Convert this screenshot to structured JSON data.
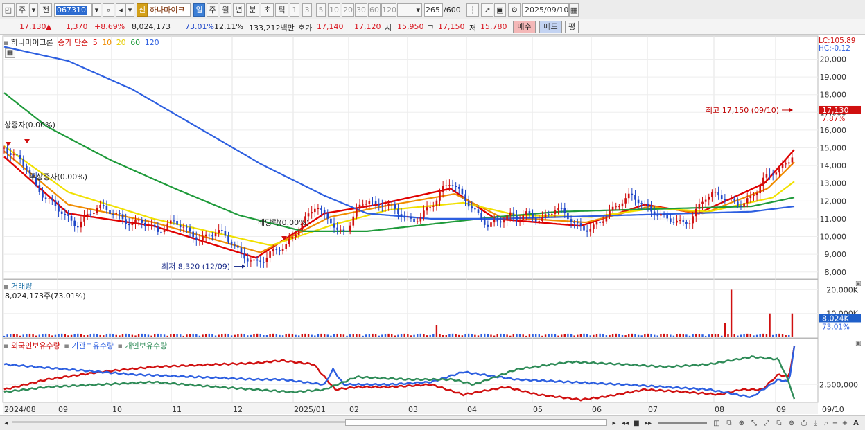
{
  "toolbar": {
    "period_type": "주",
    "prev_label": "전",
    "stock_code": "067310",
    "shin_label": "신",
    "stock_name": "하나마이크",
    "periods": [
      "일",
      "주",
      "월",
      "년",
      "분",
      "초",
      "틱"
    ],
    "active_period": "일",
    "intervals": [
      "1",
      "3",
      "5",
      "10",
      "20",
      "30",
      "60",
      "120"
    ],
    "bar_count": "265",
    "bar_total": "/600",
    "date": "2025/09/10"
  },
  "quote": {
    "price": "17,130",
    "change": "1,370",
    "change_pct": "+8.69%",
    "volume": "8,024,173",
    "volume_ratio": "73.01%",
    "turnover": "12.11%",
    "amount": "133,212백만",
    "bid_ask_label": "호가",
    "ask": "17,140",
    "bid": "17,120",
    "open_label": "시",
    "open": "15,950",
    "high_label": "고",
    "high": "17,150",
    "low_label": "저",
    "low": "15,780",
    "buy_label": "매수",
    "sell_label": "매도",
    "eval_label": "평"
  },
  "price_panel": {
    "legend": {
      "name": "하나마이크론",
      "type": "종가 단순",
      "mas": [
        {
          "label": "5",
          "color": "#e00000"
        },
        {
          "label": "10",
          "color": "#f08c00"
        },
        {
          "label": "20",
          "color": "#f0e000"
        },
        {
          "label": "60",
          "color": "#1e9a3a"
        },
        {
          "label": "120",
          "color": "#2d5fe0"
        }
      ]
    },
    "lc_label": "LC:105.89",
    "hc_label": "HC:-0.12",
    "y_ticks": [
      "20,000",
      "19,000",
      "18,000",
      "17,000",
      "16,000",
      "15,000",
      "14,000",
      "13,000",
      "12,000",
      "11,000",
      "10,000",
      "9,000",
      "8,000"
    ],
    "current_price": "17,130",
    "current_pct": "7.87%",
    "annotations": {
      "high": "최고 17,150 (09/10)",
      "low": "최저 8,320 (12/09)",
      "event1": "상증자(0.00%)",
      "event2": "무상증자(0.00%)",
      "event3": "배당락(0.00%)"
    }
  },
  "volume_panel": {
    "title": "거래량",
    "value": "8,024,173주(73.01%)",
    "y_ticks": [
      "20,000K",
      "10,000K"
    ],
    "current": "8,024K",
    "current_pct": "73.01%"
  },
  "holdings_panel": {
    "legend": [
      {
        "label": "외국인보유수량",
        "color": "#d01010"
      },
      {
        "label": "기관보유수량",
        "color": "#2d5fe0"
      },
      {
        "label": "개인보유수량",
        "color": "#2e8b57"
      }
    ],
    "y_ticks": [
      "2,500,000"
    ]
  },
  "x_axis": {
    "labels": [
      "2024/08",
      "09",
      "10",
      "11",
      "12",
      "2025/01",
      "02",
      "03",
      "04",
      "05",
      "06",
      "07",
      "08",
      "09"
    ],
    "last_date": "09/10"
  },
  "chart_data": {
    "type": "candlestick",
    "title": "하나마이크론",
    "ylim": [
      7600,
      20800
    ],
    "price_path": [
      [
        0,
        15000
      ],
      [
        8,
        14600
      ],
      [
        15,
        14300
      ],
      [
        22,
        13800
      ],
      [
        30,
        12800
      ],
      [
        38,
        12200
      ],
      [
        45,
        11900
      ],
      [
        52,
        11500
      ],
      [
        60,
        11000
      ],
      [
        68,
        10600
      ],
      [
        75,
        11000
      ],
      [
        80,
        11300
      ],
      [
        88,
        11700
      ],
      [
        96,
        11500
      ],
      [
        104,
        11300
      ],
      [
        112,
        10900
      ],
      [
        120,
        10700
      ],
      [
        128,
        10900
      ],
      [
        136,
        10600
      ],
      [
        144,
        10300
      ],
      [
        152,
        10600
      ],
      [
        160,
        10900
      ],
      [
        168,
        10500
      ],
      [
        176,
        10100
      ],
      [
        184,
        9800
      ],
      [
        192,
        10100
      ],
      [
        200,
        10300
      ],
      [
        208,
        10000
      ],
      [
        215,
        9500
      ],
      [
        222,
        9000
      ],
      [
        229,
        8700
      ],
      [
        236,
        8500
      ],
      [
        243,
        8700
      ],
      [
        250,
        9100
      ],
      [
        257,
        9300
      ],
      [
        264,
        9500
      ],
      [
        271,
        10000
      ],
      [
        278,
        10700
      ],
      [
        285,
        11200
      ],
      [
        292,
        11800
      ],
      [
        299,
        11200
      ],
      [
        306,
        10900
      ],
      [
        313,
        10200
      ],
      [
        320,
        10300
      ],
      [
        327,
        11100
      ],
      [
        334,
        11800
      ],
      [
        341,
        12100
      ],
      [
        348,
        11700
      ],
      [
        355,
        11900
      ],
      [
        362,
        11700
      ],
      [
        369,
        11400
      ],
      [
        376,
        11000
      ],
      [
        383,
        10900
      ],
      [
        390,
        11100
      ],
      [
        397,
        11600
      ],
      [
        404,
        12000
      ],
      [
        411,
        12700
      ],
      [
        418,
        13100
      ],
      [
        425,
        12600
      ],
      [
        432,
        12100
      ],
      [
        439,
        11500
      ],
      [
        446,
        11100
      ],
      [
        453,
        10600
      ],
      [
        460,
        10800
      ],
      [
        467,
        11000
      ],
      [
        474,
        11200
      ],
      [
        481,
        11000
      ],
      [
        488,
        11300
      ],
      [
        495,
        11100
      ],
      [
        502,
        10900
      ],
      [
        509,
        11200
      ],
      [
        516,
        11600
      ],
      [
        523,
        11400
      ],
      [
        530,
        11000
      ],
      [
        537,
        10600
      ],
      [
        544,
        10400
      ],
      [
        551,
        10500
      ],
      [
        558,
        10800
      ],
      [
        565,
        11300
      ],
      [
        572,
        11600
      ],
      [
        579,
        12000
      ],
      [
        586,
        12300
      ],
      [
        593,
        12100
      ],
      [
        600,
        11700
      ],
      [
        607,
        11400
      ],
      [
        614,
        11200
      ],
      [
        621,
        11000
      ],
      [
        628,
        10900
      ],
      [
        635,
        10700
      ],
      [
        642,
        10900
      ],
      [
        649,
        11500
      ],
      [
        656,
        12200
      ],
      [
        663,
        12400
      ],
      [
        670,
        12300
      ],
      [
        677,
        12100
      ],
      [
        684,
        11900
      ],
      [
        691,
        11800
      ],
      [
        698,
        12100
      ],
      [
        705,
        12600
      ],
      [
        712,
        13300
      ],
      [
        719,
        13600
      ],
      [
        726,
        13800
      ],
      [
        733,
        14100
      ],
      [
        738,
        14600
      ],
      [
        740,
        17130
      ]
    ],
    "ma_lines": [
      {
        "name": "5",
        "color": "#e00000",
        "values": [
          [
            0,
            14500
          ],
          [
            60,
            11300
          ],
          [
            140,
            10600
          ],
          [
            236,
            8800
          ],
          [
            300,
            11300
          ],
          [
            350,
            11800
          ],
          [
            418,
            12700
          ],
          [
            460,
            11000
          ],
          [
            540,
            10600
          ],
          [
            600,
            11800
          ],
          [
            650,
            11300
          ],
          [
            712,
            13000
          ],
          [
            740,
            14900
          ]
        ]
      },
      {
        "name": "10",
        "color": "#f08c00",
        "values": [
          [
            0,
            14800
          ],
          [
            60,
            11800
          ],
          [
            140,
            10800
          ],
          [
            240,
            9100
          ],
          [
            305,
            11100
          ],
          [
            355,
            11700
          ],
          [
            422,
            12400
          ],
          [
            465,
            11100
          ],
          [
            545,
            10800
          ],
          [
            605,
            11700
          ],
          [
            655,
            11300
          ],
          [
            715,
            12700
          ],
          [
            740,
            14200
          ]
        ]
      },
      {
        "name": "20",
        "color": "#f0e000",
        "values": [
          [
            0,
            15100
          ],
          [
            60,
            12500
          ],
          [
            140,
            11000
          ],
          [
            250,
            9500
          ],
          [
            310,
            10700
          ],
          [
            360,
            11500
          ],
          [
            430,
            11900
          ],
          [
            480,
            11200
          ],
          [
            550,
            11100
          ],
          [
            610,
            11600
          ],
          [
            660,
            11400
          ],
          [
            720,
            12200
          ],
          [
            740,
            13100
          ]
        ]
      },
      {
        "name": "60",
        "color": "#1e9a3a",
        "values": [
          [
            0,
            18100
          ],
          [
            40,
            16200
          ],
          [
            100,
            14300
          ],
          [
            160,
            12700
          ],
          [
            220,
            11200
          ],
          [
            280,
            10300
          ],
          [
            340,
            10300
          ],
          [
            400,
            10700
          ],
          [
            460,
            11100
          ],
          [
            520,
            11400
          ],
          [
            580,
            11500
          ],
          [
            640,
            11600
          ],
          [
            700,
            11700
          ],
          [
            740,
            12200
          ]
        ]
      },
      {
        "name": "120",
        "color": "#2d5fe0",
        "values": [
          [
            0,
            20700
          ],
          [
            60,
            19900
          ],
          [
            120,
            18300
          ],
          [
            180,
            16200
          ],
          [
            240,
            14100
          ],
          [
            300,
            12300
          ],
          [
            340,
            11300
          ],
          [
            400,
            11000
          ],
          [
            460,
            11000
          ],
          [
            520,
            11100
          ],
          [
            580,
            11200
          ],
          [
            640,
            11300
          ],
          [
            700,
            11400
          ],
          [
            740,
            11700
          ]
        ]
      }
    ],
    "volume_peaks": [
      {
        "x": 404,
        "value": 5000,
        "color": "#d01010"
      },
      {
        "x": 680,
        "value": 20000,
        "color": "#d01010"
      },
      {
        "x": 676,
        "value": 6000,
        "color": "#d01010"
      },
      {
        "x": 716,
        "value": 10000,
        "color": "#d01010"
      },
      {
        "x": 738,
        "value": 10000,
        "color": "#d01010"
      },
      {
        "x": 740,
        "value": 8024,
        "color": "#d01010"
      }
    ],
    "holdings": [
      {
        "name": "외국인보유수량",
        "color": "#d01010",
        "values": [
          [
            0,
            2300
          ],
          [
            40,
            2700
          ],
          [
            90,
            3000
          ],
          [
            140,
            3200
          ],
          [
            200,
            3300
          ],
          [
            236,
            3350
          ],
          [
            260,
            3450
          ],
          [
            290,
            3300
          ],
          [
            310,
            2300
          ],
          [
            330,
            2400
          ],
          [
            360,
            2400
          ],
          [
            400,
            2500
          ],
          [
            430,
            2100
          ],
          [
            470,
            2400
          ],
          [
            500,
            2100
          ],
          [
            540,
            1900
          ],
          [
            560,
            2000
          ],
          [
            600,
            2300
          ],
          [
            640,
            2200
          ],
          [
            670,
            2100
          ],
          [
            690,
            2300
          ],
          [
            710,
            2300
          ],
          [
            725,
            2900
          ],
          [
            735,
            2800
          ],
          [
            740,
            4000
          ]
        ]
      },
      {
        "name": "기관보유수량",
        "color": "#2d5fe0",
        "values": [
          [
            0,
            3300
          ],
          [
            60,
            3100
          ],
          [
            120,
            2900
          ],
          [
            180,
            2800
          ],
          [
            236,
            2700
          ],
          [
            260,
            2700
          ],
          [
            300,
            2500
          ],
          [
            308,
            3100
          ],
          [
            318,
            2500
          ],
          [
            360,
            2500
          ],
          [
            400,
            2600
          ],
          [
            430,
            3000
          ],
          [
            480,
            2700
          ],
          [
            530,
            2600
          ],
          [
            580,
            2500
          ],
          [
            620,
            2400
          ],
          [
            660,
            2300
          ],
          [
            700,
            2000
          ],
          [
            725,
            2700
          ],
          [
            735,
            2600
          ],
          [
            740,
            4000
          ]
        ]
      },
      {
        "name": "개인보유수량",
        "color": "#2e8b57",
        "values": [
          [
            0,
            2200
          ],
          [
            40,
            2400
          ],
          [
            90,
            2500
          ],
          [
            140,
            2600
          ],
          [
            200,
            2400
          ],
          [
            236,
            2300
          ],
          [
            270,
            2200
          ],
          [
            300,
            2300
          ],
          [
            330,
            2800
          ],
          [
            380,
            2700
          ],
          [
            420,
            2700
          ],
          [
            440,
            2500
          ],
          [
            480,
            3100
          ],
          [
            530,
            3400
          ],
          [
            580,
            3300
          ],
          [
            620,
            3200
          ],
          [
            660,
            3300
          ],
          [
            700,
            3600
          ],
          [
            725,
            3500
          ],
          [
            735,
            2600
          ],
          [
            740,
            1900
          ]
        ]
      }
    ]
  }
}
